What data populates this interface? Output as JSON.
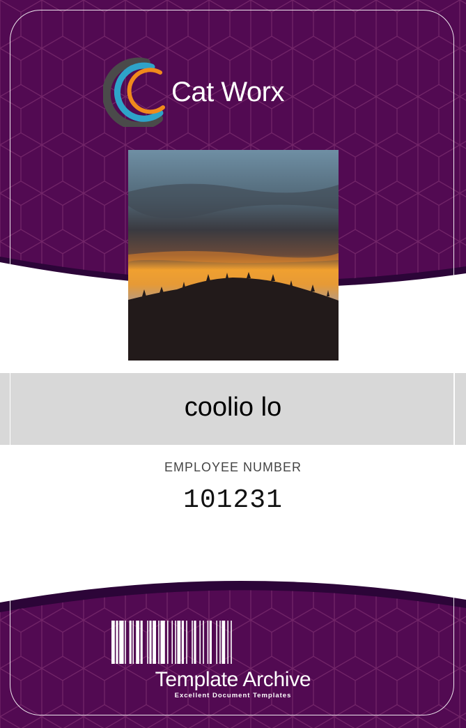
{
  "company": {
    "name": "Cat Worx",
    "logo_icon": "cat-worx-logo-icon",
    "colors": {
      "ring_outer": "#4a4a4a",
      "ring_blue": "#2ea3c9",
      "ring_orange": "#f08a1c"
    }
  },
  "theme": {
    "band": "#520a52",
    "band_edge": "#2c0538",
    "hex_line": "#7a2c6e",
    "name_bar": "#d8d8d8"
  },
  "employee": {
    "photo_icon": "sunset-photo",
    "name": "coolio lo",
    "number_label": "EMPLOYEE NUMBER",
    "number": "101231"
  },
  "footer": {
    "barcode_icon": "barcode-icon",
    "brand": "Template Archive",
    "tagline": "Excellent Document Templates"
  }
}
